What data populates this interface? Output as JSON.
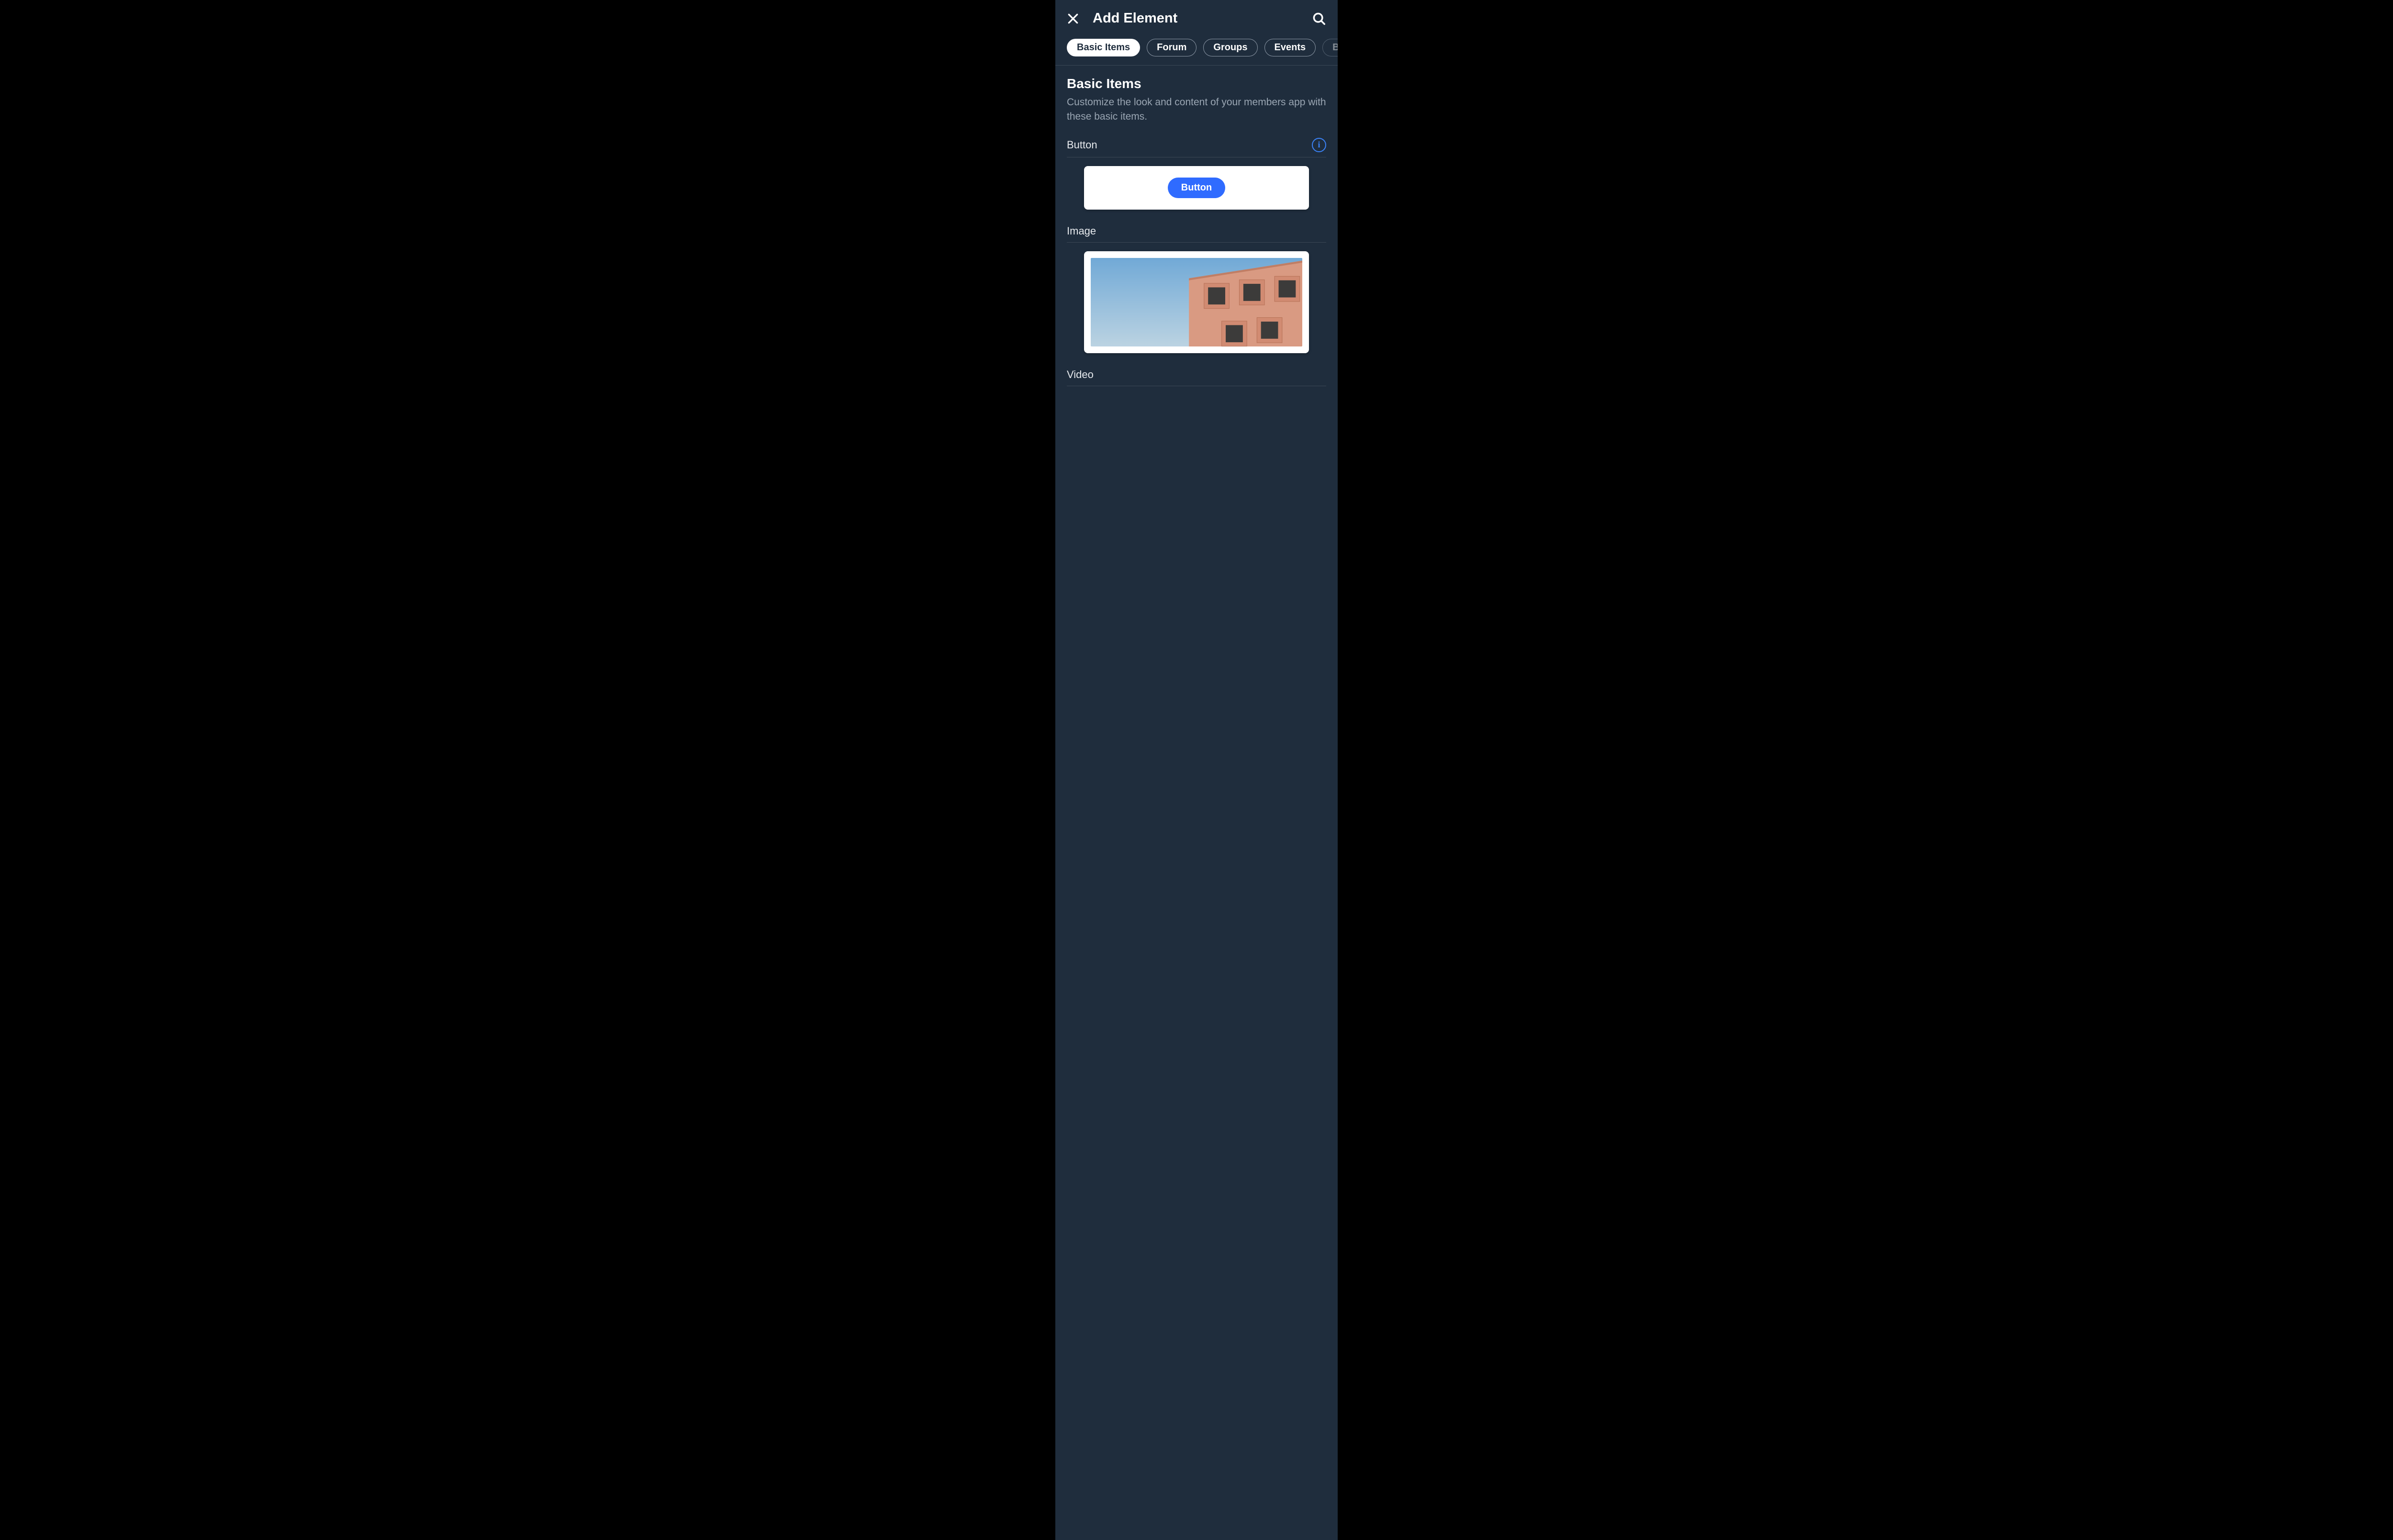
{
  "header": {
    "title": "Add Element"
  },
  "tabs": [
    {
      "label": "Basic Items",
      "active": true
    },
    {
      "label": "Forum"
    },
    {
      "label": "Groups"
    },
    {
      "label": "Events"
    },
    {
      "label": "Blog",
      "faded": true
    }
  ],
  "section": {
    "title": "Basic Items",
    "description": "Customize the look and content of your members app with these basic items."
  },
  "items": {
    "button": {
      "label": "Button",
      "preview_text": "Button"
    },
    "image": {
      "label": "Image"
    },
    "video": {
      "label": "Video"
    }
  }
}
